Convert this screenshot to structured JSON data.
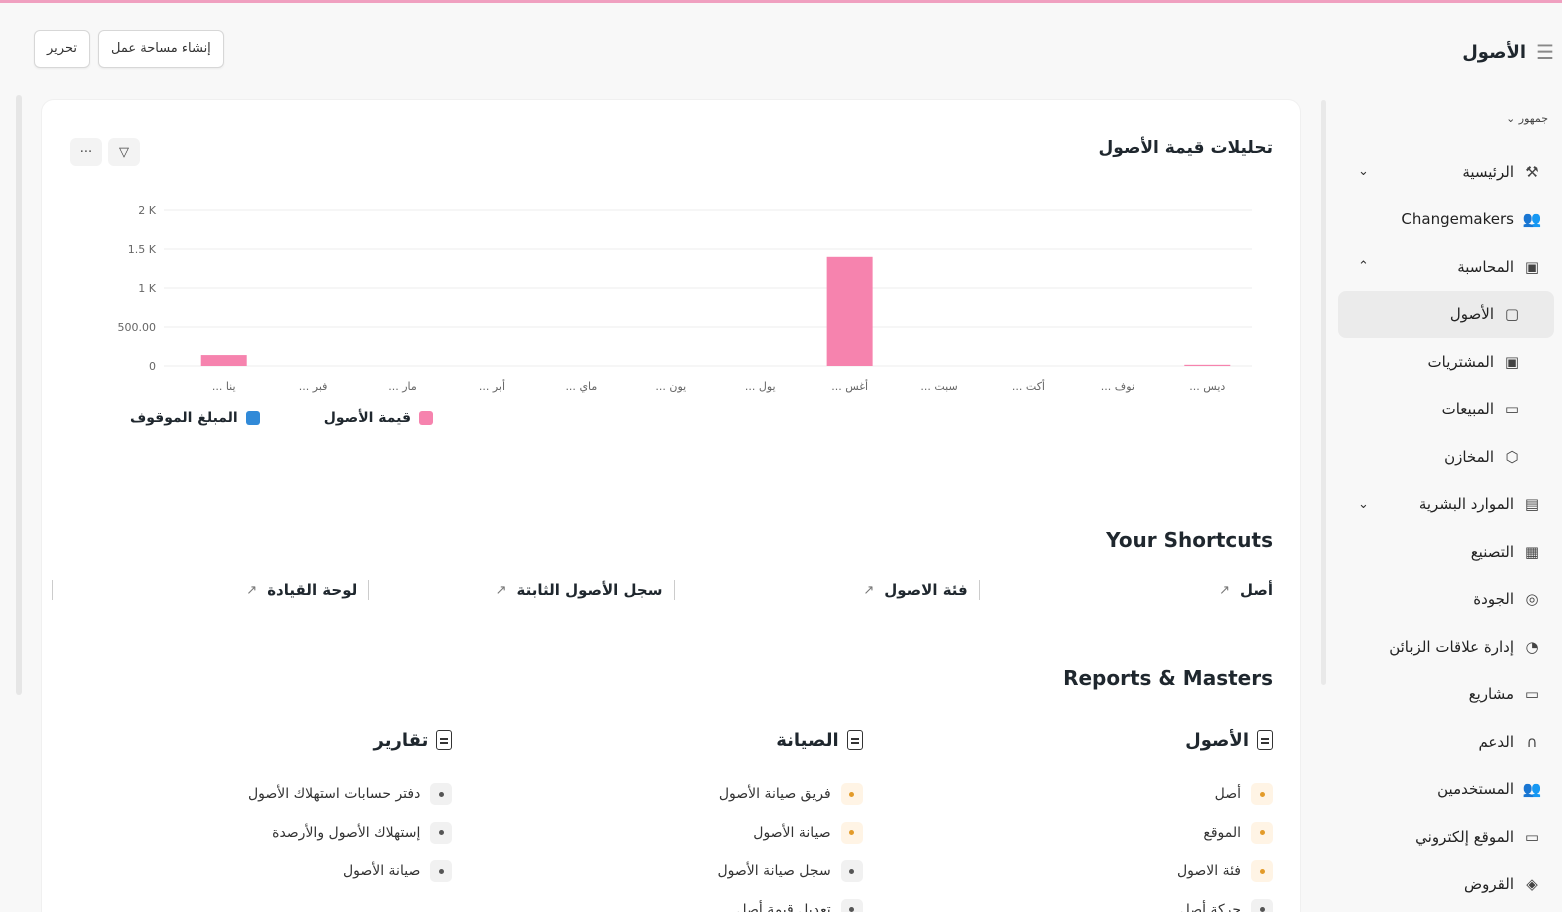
{
  "header": {
    "title": "الأصول",
    "buttons": {
      "edit": "تحرير",
      "create_workspace": "إنشاء مساحة عمل"
    }
  },
  "sidebar": {
    "workspace_switch": "جمهور ⌄",
    "items": [
      {
        "label": "الرئيسية",
        "icon": "tools-icon",
        "caret": "⌄"
      },
      {
        "label": "Changemakers",
        "icon": "users-icon"
      },
      {
        "label": "المحاسبة",
        "icon": "accounting-icon",
        "caret": "⌃"
      },
      {
        "label": "الأصول",
        "icon": "asset-icon",
        "active": true
      },
      {
        "label": "المشتريات",
        "icon": "purchase-icon"
      },
      {
        "label": "المبيعات",
        "icon": "sales-icon"
      },
      {
        "label": "المخازن",
        "icon": "box-icon"
      },
      {
        "label": "الموارد البشرية",
        "icon": "hr-icon",
        "caret": "⌄"
      },
      {
        "label": "التصنيع",
        "icon": "building-icon"
      },
      {
        "label": "الجودة",
        "icon": "quality-icon"
      },
      {
        "label": "إدارة علاقات الزبائن",
        "icon": "crm-icon"
      },
      {
        "label": "مشاريع",
        "icon": "folder-icon"
      },
      {
        "label": "الدعم",
        "icon": "support-icon"
      },
      {
        "label": "المستخدمين",
        "icon": "users-icon"
      },
      {
        "label": "الموقع إلكتروني",
        "icon": "website-icon"
      },
      {
        "label": "القروض",
        "icon": "loan-icon"
      }
    ]
  },
  "chart_section": {
    "title": "تحليلات قيمة الأصول",
    "filter_icon": "▽",
    "more_icon": "···"
  },
  "chart_data": {
    "type": "bar",
    "categories": [
      "... ينا",
      "... فبر",
      "... مار",
      "... أبر",
      "... ماي",
      "... يون",
      "... يول",
      "... أغس",
      "... سبت",
      "... أكت",
      "... نوف",
      "... ديس"
    ],
    "y_ticks": [
      "0",
      "500.00",
      "1 K",
      "1.5 K",
      "2 K"
    ],
    "ylim": [
      0,
      2000
    ],
    "series": [
      {
        "name": "قيمة الأصول",
        "color": "#f683ae",
        "values": [
          140,
          0,
          0,
          0,
          0,
          0,
          0,
          1400,
          0,
          0,
          0,
          15
        ]
      },
      {
        "name": "المبلغ الموقوف",
        "color": "#318ad8",
        "values": [
          0,
          0,
          0,
          0,
          0,
          0,
          0,
          0,
          0,
          0,
          0,
          0
        ]
      }
    ],
    "grid": true,
    "legend": "bottom-left"
  },
  "shortcuts": {
    "title": "Your Shortcuts",
    "items": [
      "أصل",
      "فئة الاصول",
      "سجل الأصول الثابتة",
      "لوحة القيادة"
    ],
    "arrow": "↗"
  },
  "reports": {
    "title": "Reports & Masters",
    "columns": [
      {
        "title": "الأصول",
        "items": [
          {
            "label": "أصل",
            "tone": "orange"
          },
          {
            "label": "الموقع",
            "tone": "orange"
          },
          {
            "label": "فئة الاصول",
            "tone": "orange"
          },
          {
            "label": "حركة أصل",
            "tone": "gray"
          }
        ]
      },
      {
        "title": "الصيانة",
        "items": [
          {
            "label": "فريق صيانة الأصول",
            "tone": "orange"
          },
          {
            "label": "صيانة الأصول",
            "tone": "orange"
          },
          {
            "label": "سجل صيانة الأصول",
            "tone": "gray"
          },
          {
            "label": "تعديل قيمة أصل",
            "tone": "gray"
          }
        ]
      },
      {
        "title": "تقارير",
        "items": [
          {
            "label": "دفتر حسابات استهلاك الأصول",
            "tone": "gray"
          },
          {
            "label": "إستهلاك الأصول والأرصدة",
            "tone": "gray"
          },
          {
            "label": "صيانة الأصول",
            "tone": "gray"
          }
        ]
      }
    ]
  }
}
